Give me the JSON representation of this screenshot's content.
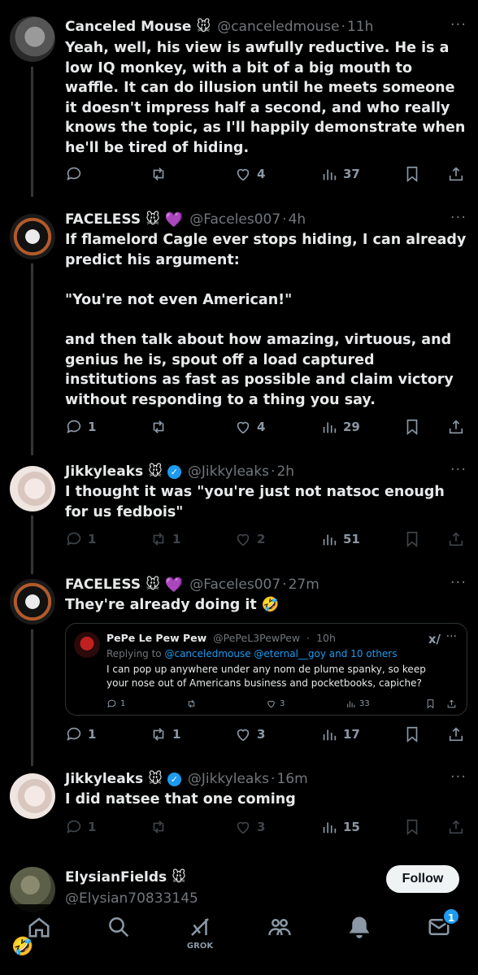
{
  "tweets": [
    {
      "name": "Canceled Mouse",
      "emoji": "🐭",
      "handle": "@canceledmouse",
      "time": "11h",
      "text": "Yeah, well, his view is awfully reductive. He is a low IQ monkey, with a bit of a big mouth to waffle. It can do illusion until he meets someone it doesn't impress half a second, and who really knows the topic, as I'll happily demonstrate when he'll be tired of hiding.",
      "replies": "",
      "reposts": "",
      "likes": "4",
      "views": "37"
    },
    {
      "name": "FACELESS",
      "emoji": "🐭",
      "emoji2": "💜",
      "handle": "@Faceles007",
      "time": "4h",
      "text": "If flamelord Cagle ever stops hiding, I can already predict his argument:\n\n\"You're not even American!\"\n\nand then talk about how amazing, virtuous, and genius he is, spout off a load captured institutions as fast as possible and claim victory without responding to a thing you say.",
      "replies": "1",
      "reposts": "",
      "likes": "4",
      "views": "29"
    },
    {
      "name": "Jikkyleaks",
      "emoji": "🐭",
      "handle": "@Jikkyleaks",
      "time": "2h",
      "text": "I thought it was \"you're just not natsoc enough for us fedbois\"",
      "replies": "1",
      "reposts": "1",
      "likes": "2",
      "views": "51"
    },
    {
      "name": "FACELESS",
      "emoji": "🐭",
      "emoji2": "💜",
      "handle": "@Faceles007",
      "time": "27m",
      "text": "They're already doing it 🤣",
      "replies": "1",
      "reposts": "1",
      "likes": "3",
      "views": "17",
      "quote": {
        "name": "PePe Le Pew Pew",
        "handle": "@PePeL3PewPew",
        "time": "10h",
        "reply_prefix": "Replying to ",
        "reply_mentions": "@canceledmouse @eternal__goy and 10 others",
        "text": "I can pop up anywhere under any nom de plume spanky, so keep your nose out of Americans business and pocketbooks, capiche?",
        "replies": "1",
        "likes": "3",
        "views": "33"
      }
    },
    {
      "name": "Jikkyleaks",
      "emoji": "🐭",
      "handle": "@Jikkyleaks",
      "time": "16m",
      "text": "I did natsee that one coming",
      "replies": "1",
      "reposts": "",
      "likes": "3",
      "views": "15"
    },
    {
      "name": "ElysianFields",
      "emoji": "🐭",
      "handle": "@Elysian70833145",
      "follow_label": "Follow"
    }
  ],
  "dot": "·",
  "more": "···",
  "nav": {
    "grok_label": "GROK",
    "notif_badge": "1"
  },
  "float_emoji": "🤣",
  "colors": {
    "background": "#000000",
    "text": "#e7e9ea",
    "muted": "#71767b",
    "accent": "#1d9bf0"
  }
}
